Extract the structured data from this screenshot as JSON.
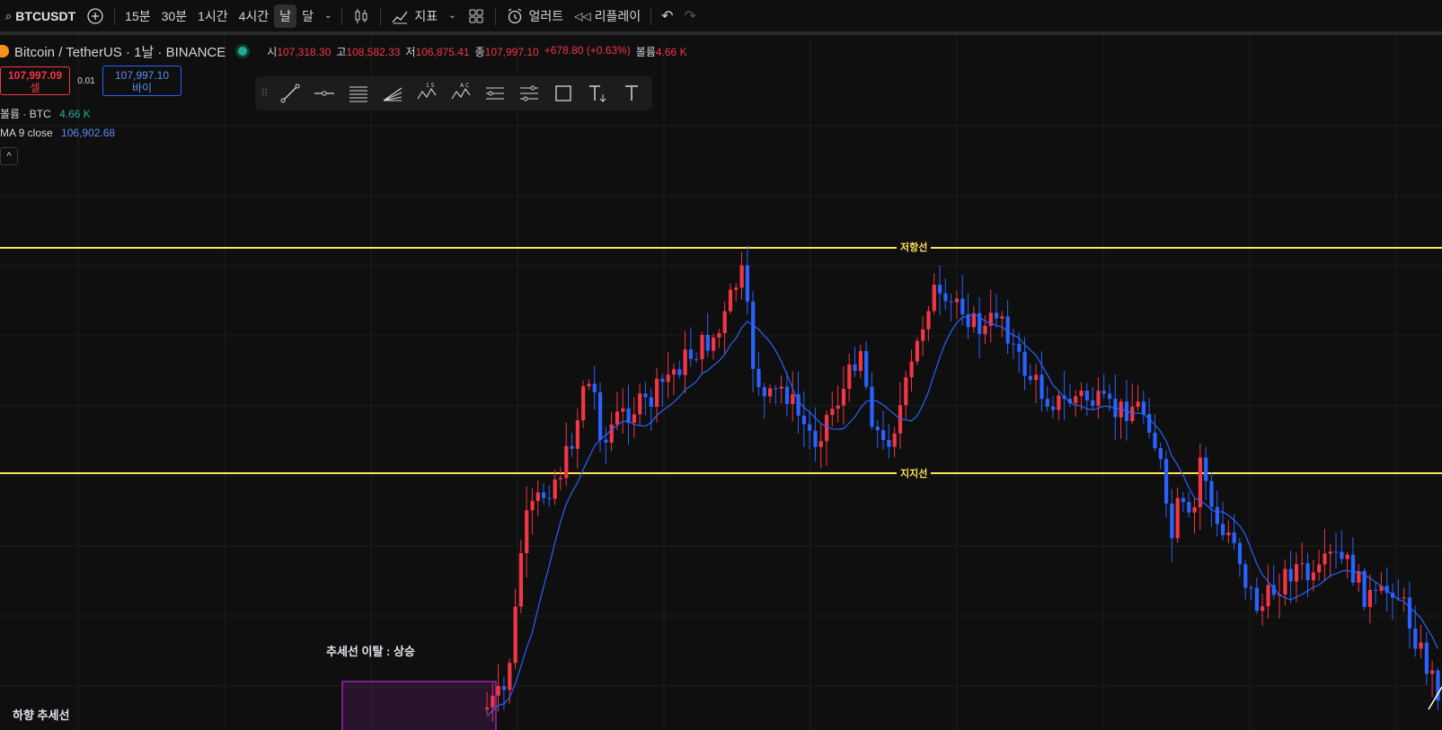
{
  "toolbar": {
    "symbol": "BTCUSDT",
    "intervals": [
      "15분",
      "30분",
      "1시간",
      "4시간",
      "날",
      "달"
    ],
    "active_interval": "날",
    "indicators_label": "지표",
    "alert_label": "얼러트",
    "replay_label": "리플레이"
  },
  "legend": {
    "title": "Bitcoin / TetherUS · 1날 · BINANCE",
    "open_label": "시",
    "open": "107,318.30",
    "high_label": "고",
    "high": "108,582.33",
    "low_label": "저",
    "low": "106,875.41",
    "close_label": "종",
    "close": "107,997.10",
    "change": "+678.80 (+0.63%)",
    "volume_label": "볼륨",
    "volume": "4.66 K"
  },
  "trade": {
    "sell_price": "107,997.09",
    "sell_label": "셀",
    "spread": "0.01",
    "buy_price": "107,997.10",
    "buy_label": "바이"
  },
  "indicators": {
    "volume_name": "볼륨 · BTC",
    "volume_value": "4.66 K",
    "ma_name": "MA 9 close",
    "ma_value": "106,902.68"
  },
  "drawing_tools": [
    "trend-line-icon",
    "horizontal-ray-icon",
    "parallel-channel-icon",
    "fib-fan-icon",
    "xabcd-pattern-icon",
    "abcd-pattern-icon",
    "position-long-icon",
    "price-range-icon",
    "rectangle-icon",
    "text-anchored-icon",
    "text-icon"
  ],
  "annotations": {
    "resistance": "저항선",
    "support": "지지선",
    "breakout": "추세선 이탈 : 상승",
    "downtrend": "하향 추세선"
  },
  "colors": {
    "background": "#0f0f0f",
    "up": "#f23645",
    "down": "#2962ff",
    "ma": "#2962ff",
    "level_line": "#ffe45c",
    "box_border": "#9c27b0"
  },
  "chart_data": {
    "type": "candlestick",
    "title": "",
    "xlabel": "",
    "ylabel": "",
    "grid": true,
    "series": [
      {
        "name": "MA 9 close",
        "last_value": 106902.68
      }
    ],
    "horizontal_levels": [
      {
        "label": "저항선",
        "value": 108350
      },
      {
        "label": "지지선",
        "value": 103000
      }
    ],
    "last_close": 107997.1
  }
}
